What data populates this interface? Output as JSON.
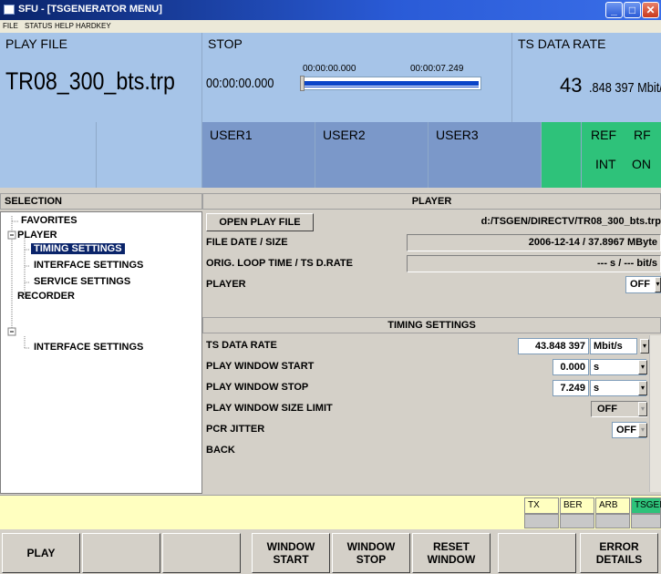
{
  "window": {
    "title": "SFU - [TSGENERATOR MENU]",
    "min": "_",
    "max": "□",
    "close": "✕"
  },
  "menu": [
    "FILE",
    "STATUS",
    "HELP",
    "HARDKEY"
  ],
  "header": {
    "play_file_label": "PLAY FILE",
    "play_file_name": "TR08_300_bts.trp",
    "state_label": "STOP",
    "current_time": "00:00:00.000",
    "position_time": "00:00:00.000",
    "end_time": "00:00:07.249",
    "progress": 1.0,
    "rate_label": "TS DATA RATE",
    "rate_big": "43",
    "rate_small": ".848 397 Mbit/s",
    "users": [
      "USER1",
      "USER2",
      "USER3"
    ],
    "ref_top": "REF",
    "ref_bottom": "INT",
    "rf_top": "RF",
    "rf_bottom": "ON"
  },
  "selection": {
    "title": "SELECTION",
    "items": [
      "FAVORITES",
      "PLAYER",
      "TIMING SETTINGS",
      "INTERFACE SETTINGS",
      "SERVICE SETTINGS",
      "RECORDER",
      "INTERFACE SETTINGS"
    ],
    "selected_index": 2
  },
  "player": {
    "title": "PLAYER",
    "open_button": "OPEN PLAY FILE",
    "file_path": "d:/TSGEN/DIRECTV/TR08_300_bts.trp",
    "file_date_label": "FILE DATE / SIZE",
    "file_date_value": "2006-12-14 / 37.8967 MByte",
    "loop_label": "ORIG. LOOP TIME / TS D.RATE",
    "loop_value": "--- s / --- bit/s",
    "player_label": "PLAYER",
    "player_value": "OFF"
  },
  "timing": {
    "title": "TIMING SETTINGS",
    "ts_rate_label": "TS DATA RATE",
    "ts_rate_value": "43.848 397",
    "ts_rate_unit": "Mbit/s",
    "start_label": "PLAY WINDOW START",
    "start_value": "0.000",
    "start_unit": "s",
    "stop_label": "PLAY WINDOW STOP",
    "stop_value": "7.249",
    "stop_unit": "s",
    "size_limit_label": "PLAY WINDOW SIZE LIMIT",
    "size_limit_value": "OFF",
    "pcr_label": "PCR JITTER",
    "pcr_value": "OFF",
    "back_label": "BACK"
  },
  "status_tabs": [
    "TX",
    "BER",
    "ARB",
    "TSGEN"
  ],
  "softkeys": [
    "PLAY",
    "",
    "",
    "WINDOW\nSTART",
    "WINDOW\nSTOP",
    "RESET\nWINDOW",
    "",
    "ERROR\nDETAILS"
  ],
  "colors": {
    "header_blue": "#a6c4e8",
    "user_blue": "#7b98c9",
    "green": "#2ec27a",
    "select": "#0a246a"
  },
  "icons": {
    "dropdown": "chevron-down-icon"
  }
}
